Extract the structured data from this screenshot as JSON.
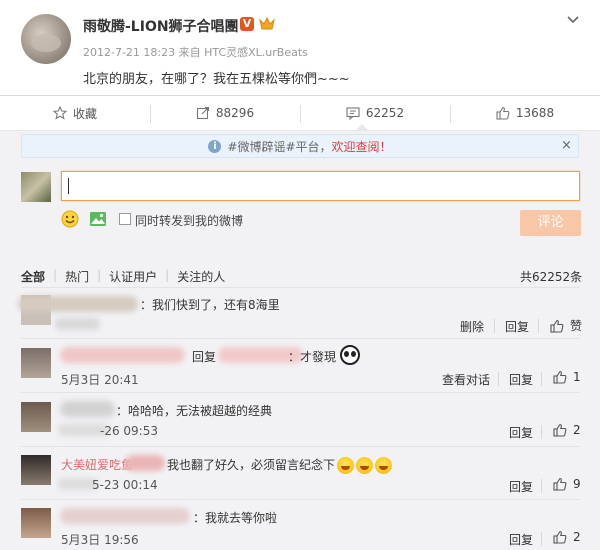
{
  "post": {
    "author": "雨敬腾-LION狮子合唱團",
    "verified_badge": "V",
    "meta": "2012-7-21 18:23 来自 HTC灵感XL.urBeats",
    "content": "北京的朋友，在哪了？我在五棵松等你們~~~"
  },
  "actions": {
    "favorite": "收藏",
    "repost": "88296",
    "comment": "62252",
    "like": "13688"
  },
  "notice": {
    "text": "#微博辟谣#平台，",
    "highlight": "欢迎查阅！",
    "close": "×"
  },
  "reply_box": {
    "value": "",
    "repost_label": "同时转发到我的微博",
    "submit_label": "评论"
  },
  "filters": {
    "all": "全部",
    "hot": "热门",
    "verified": "认证用户",
    "following": "关注的人",
    "total": "共62252条"
  },
  "comments": [
    {
      "text": "：我们快到了，还有8海里",
      "delete": "删除",
      "reply": "回复",
      "like": "赞"
    },
    {
      "reply_prefix": "回复",
      "text_tail": "：才發現",
      "time": "5月3日 20:41",
      "view_thread": "查看对话",
      "reply": "回复",
      "like_count": "1"
    },
    {
      "text": "：哈哈哈，无法被超越的经典",
      "time": "-26 09:53",
      "reply": "回复",
      "like_count": "2"
    },
    {
      "name": "大美妞爱吃鱼",
      "text": "我也翻了好久，必须留言纪念下",
      "time": "5-23 00:14",
      "reply": "回复",
      "like_count": "9"
    },
    {
      "text": "：我就去等你啦",
      "time": "5月3日 19:56",
      "reply": "回复",
      "like_count": "2"
    }
  ],
  "icons": {
    "chevron": "chevron-down-icon",
    "favorite": "star-icon",
    "repost": "repost-icon",
    "comment": "comment-icon",
    "like": "thumb-up-icon",
    "emoji": "smiley-icon",
    "image": "image-icon",
    "info": "info-icon"
  },
  "colors": {
    "accent_orange": "#f8c7a7",
    "input_focus": "#f0a04b",
    "highlight_red": "#e4393c",
    "verified_orange": "#e8541e"
  }
}
